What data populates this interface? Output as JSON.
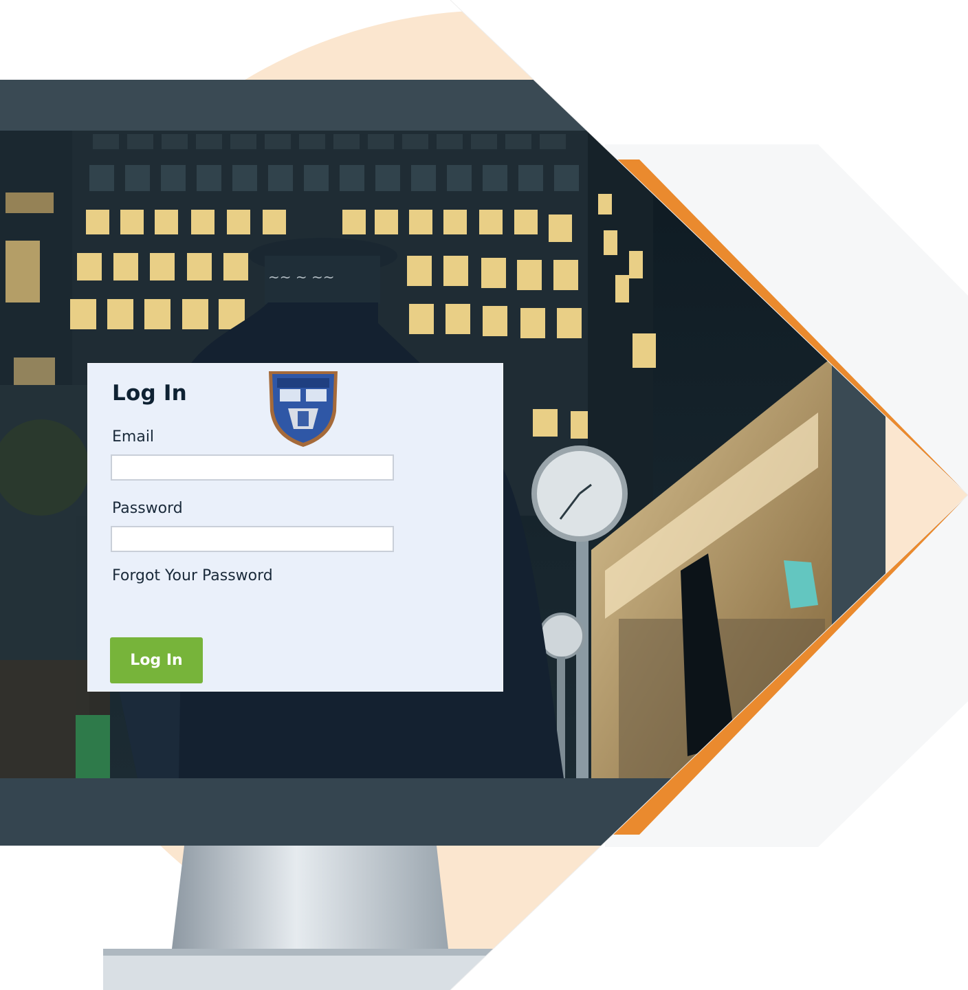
{
  "login": {
    "title": "Log In",
    "email_label": "Email",
    "email_value": "",
    "password_label": "Password",
    "password_value": "",
    "forgot_link": "Forgot Your Password",
    "submit_label": "Log In"
  },
  "colors": {
    "accent_orange": "#ea8a2e",
    "monitor_bezel": "#3a4a54",
    "button_green": "#77b43a",
    "card_background": "#eaf0fa",
    "peach_background": "#fbe6cf"
  },
  "icons": {
    "crest": "crest-logo-icon"
  }
}
